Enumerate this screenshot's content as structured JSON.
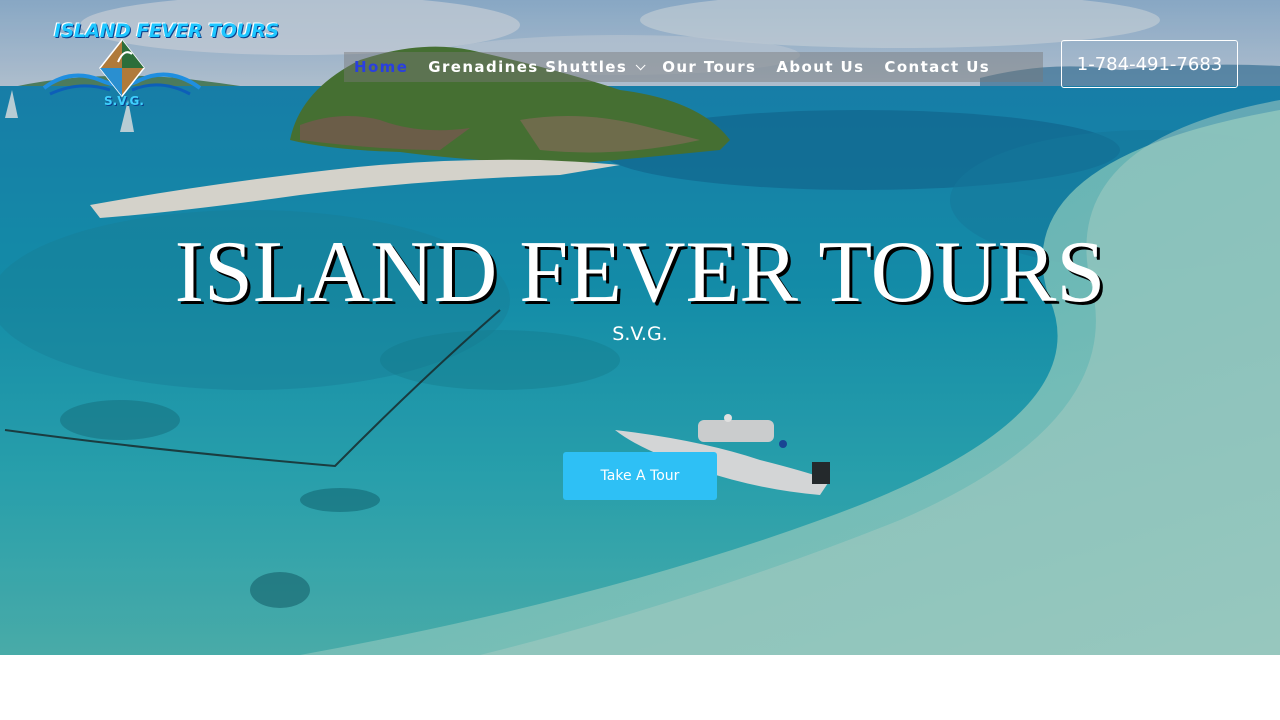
{
  "logo": {
    "title": "ISLAND FEVER TOURS",
    "subtitle": "S.V.G."
  },
  "nav": {
    "items": [
      {
        "label": "Home",
        "active": true
      },
      {
        "label": "Grenadines Shuttles",
        "has_dropdown": true
      },
      {
        "label": "Our Tours"
      },
      {
        "label": "About Us"
      },
      {
        "label": "Contact Us"
      }
    ],
    "active_color": "#2a3fe0"
  },
  "phone": {
    "label": "1-784-491-7683"
  },
  "hero": {
    "title": "ISLAND FEVER TOURS",
    "subtitle": "S.V.G.",
    "cta_label": "Take A Tour",
    "cta_color": "#2ec0f5"
  }
}
